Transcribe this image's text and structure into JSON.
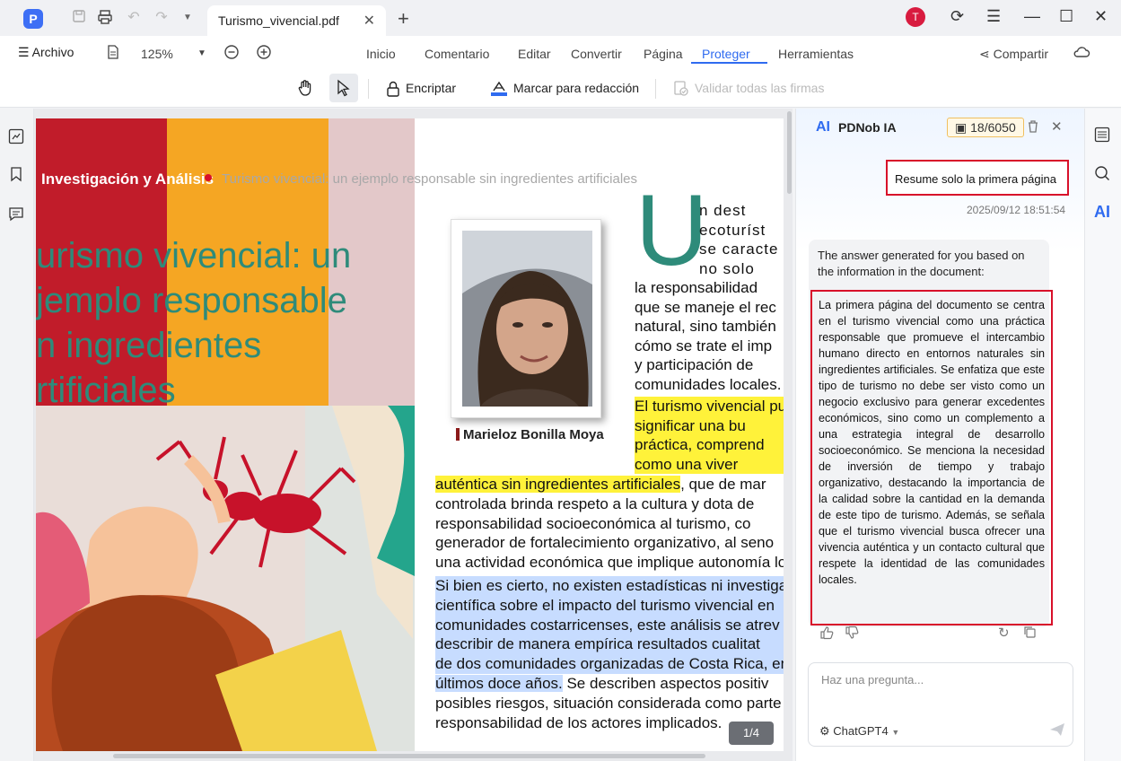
{
  "titlebar": {
    "tab_title": "Turismo_vivencial.pdf",
    "avatar_letter": "T"
  },
  "menubar": {
    "menu_label": "Archivo",
    "zoom": "125%",
    "tabs": [
      "Inicio",
      "Comentario",
      "Editar",
      "Convertir",
      "Página",
      "Proteger",
      "Herramientas"
    ],
    "active_tab": "Proteger",
    "share": "Compartir"
  },
  "toolbar": {
    "encrypt": "Encriptar",
    "redact": "Marcar para redacción",
    "validate": "Validar todas las firmas"
  },
  "document": {
    "header_section": "Investigación y Análisis",
    "header_subtitle": "Turismo vivencial: un ejemplo responsable sin ingredientes artificiales",
    "title_lines": [
      "urismo vivencial: un",
      "jemplo responsable",
      "n ingredientes",
      "rtificiales"
    ],
    "drop_cap": "U",
    "photo_caption": "Marieloz Bonilla Moya",
    "col_lines_narrow": [
      "n  dest",
      "ecoturíst",
      "se  caracte",
      "no  solo"
    ],
    "col_lines": [
      "la responsabilidad",
      "que se maneje el rec",
      "natural, sino también",
      "cómo se trate el imp",
      "y participación de",
      "comunidades locales."
    ],
    "col_yellow": [
      "El turismo vivencial pu",
      "significar una bu",
      "práctica, comprend",
      "como una viver"
    ],
    "body_yellow": "auténtica sin ingredientes artificiales",
    "body_yellow_rest": ", que de mar",
    "body_lines": [
      "controlada brinda respeto a la cultura y dota de",
      "responsabilidad socioeconómica al turismo, co",
      "generador de fortalecimiento organizativo, al seno",
      "una actividad económica que implique autonomía lo"
    ],
    "body_blue": [
      "Si bien es cierto, no existen estadísticas ni investiga",
      "científica sobre el impacto del turismo vivencial en",
      "comunidades costarricenses, este análisis se atrev",
      "describir de manera empírica resultados cualitat",
      "de dos comunidades organizadas de Costa Rica, en"
    ],
    "body_blue_last": "últimos doce años.",
    "body_blue_last_rest": " Se describen aspectos positiv",
    "body_end": [
      "posibles riesgos, situación considerada como parte d",
      "responsabilidad de los actores implicados."
    ],
    "page_indicator": "1/4"
  },
  "ai": {
    "title": "PDNob IA",
    "credits": "18/6050",
    "user_message": "Resume solo la primera página",
    "timestamp": "2025/09/12 18:51:54",
    "answer_intro": "The answer generated for you based on the information in the document:",
    "answer_body": "La primera página del documento se centra en el turismo vivencial como una práctica responsable que promueve el intercambio humano directo en entornos naturales sin ingredientes artificiales. Se enfatiza que este tipo de turismo no debe ser visto como un negocio exclusivo para generar excedentes económicos, sino como un complemento a una estrategia integral de desarrollo socioeconómico. Se menciona la necesidad de inversión de tiempo y trabajo organizativo, destacando la importancia de la calidad sobre la cantidad en la demanda de este tipo de turismo. Además, se señala que el turismo vivencial busca ofrecer una vivencia auténtica y un contacto cultural que respete la identidad de las comunidades locales.",
    "input_placeholder": "Haz una pregunta...",
    "model": "ChatGPT4"
  },
  "colors": {
    "accent": "#2f6bf0",
    "highlight_yellow": "#fff23a",
    "highlight_blue": "#c7dcff",
    "title_teal": "#2e8b7a",
    "annotation_red": "#d8102a"
  }
}
